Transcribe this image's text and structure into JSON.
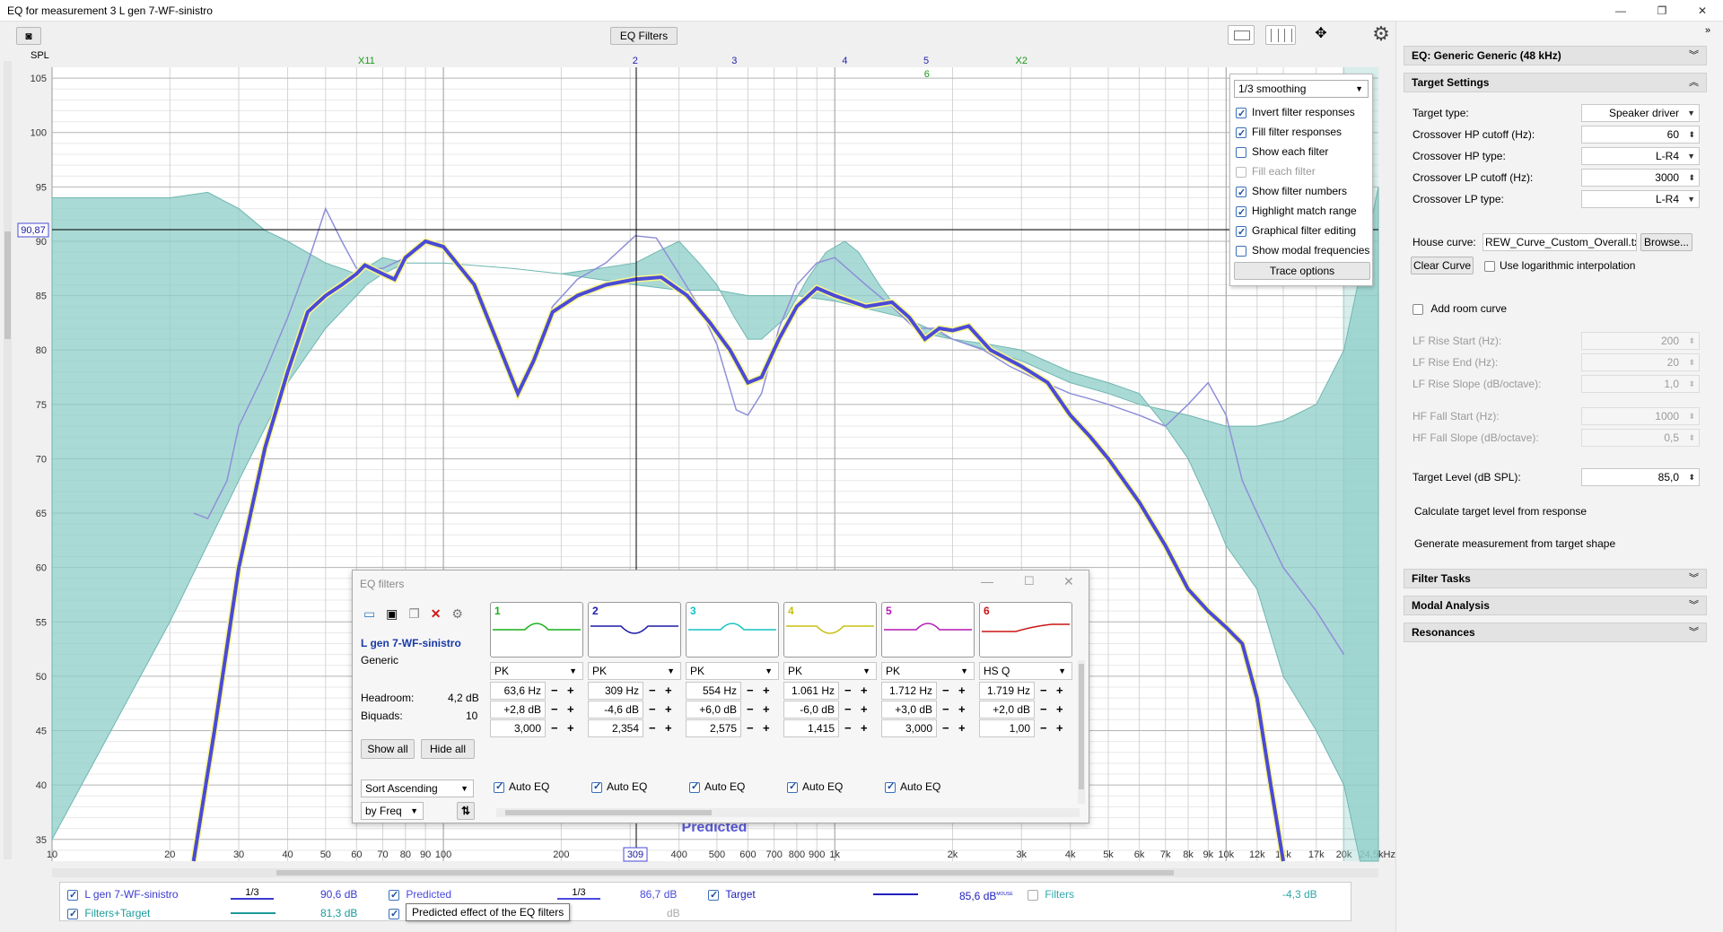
{
  "window": {
    "title": "EQ for measurement 3 L gen 7-WF-sinistro",
    "minimize": "—",
    "maximize": "❐",
    "close": "✕"
  },
  "toolbar": {
    "eq_filters_button": "EQ Filters",
    "spl_label": "SPL"
  },
  "graph": {
    "y_ticks": [
      "105",
      "100",
      "95",
      "90",
      "85",
      "80",
      "75",
      "70",
      "65",
      "60",
      "55",
      "50",
      "45",
      "40",
      "35"
    ],
    "x_ticks": [
      "10",
      "20",
      "30",
      "40",
      "50",
      "60",
      "70",
      "80",
      "90",
      "100",
      "200",
      "300",
      "400",
      "500",
      "600",
      "700",
      "800",
      "900",
      "1k",
      "2k",
      "3k",
      "4k",
      "5k",
      "6k",
      "7k",
      "8k",
      "9k",
      "10k",
      "12k",
      "14k",
      "17k",
      "20k",
      "24,5kHz"
    ],
    "x_cursor_value": "309",
    "y_cursor_value": "90,87",
    "top_markers": [
      "X11",
      "2",
      "3",
      "4",
      "5",
      "6",
      "X2"
    ],
    "predicted_label": "Predicted"
  },
  "trace_options": {
    "smoothing": "1/3 smoothing",
    "items": [
      {
        "label": "Invert filter responses",
        "checked": true,
        "disabled": false
      },
      {
        "label": "Fill filter responses",
        "checked": true,
        "disabled": false
      },
      {
        "label": "Show each filter",
        "checked": false,
        "disabled": false
      },
      {
        "label": "Fill each filter",
        "checked": false,
        "disabled": true
      },
      {
        "label": "Show filter numbers",
        "checked": true,
        "disabled": false
      },
      {
        "label": "Highlight match range",
        "checked": true,
        "disabled": false
      },
      {
        "label": "Graphical filter editing",
        "checked": true,
        "disabled": false
      },
      {
        "label": "Show modal frequencies",
        "checked": false,
        "disabled": false
      }
    ],
    "button": "Trace options"
  },
  "eq_window": {
    "title": "EQ filters",
    "measurement_name": "L gen 7-WF-sinistro",
    "equaliser": "Generic",
    "headroom_label": "Headroom:",
    "headroom_value": "4,2 dB",
    "biquads_label": "Biquads:",
    "biquads_value": "10",
    "show_all": "Show all",
    "hide_all": "Hide all",
    "sort_select": "Sort Ascending",
    "sort_by": "by Freq",
    "filters": [
      {
        "num": "1",
        "color": "#19b019",
        "type": "PK",
        "freq": "63,6 Hz",
        "gain": "+2,8 dB",
        "q": "3,000",
        "auto": "Auto EQ",
        "shape": "peak"
      },
      {
        "num": "2",
        "color": "#1c1ca8",
        "type": "PK",
        "freq": "309 Hz",
        "gain": "-4,6 dB",
        "q": "2,354",
        "auto": "Auto EQ",
        "shape": "dip"
      },
      {
        "num": "3",
        "color": "#14c2c2",
        "type": "PK",
        "freq": "554 Hz",
        "gain": "+6,0 dB",
        "q": "2,575",
        "auto": "Auto EQ",
        "shape": "peak"
      },
      {
        "num": "4",
        "color": "#c8c012",
        "type": "PK",
        "freq": "1.061 Hz",
        "gain": "-6,0 dB",
        "q": "1,415",
        "auto": "Auto EQ",
        "shape": "dip"
      },
      {
        "num": "5",
        "color": "#b418b4",
        "type": "PK",
        "freq": "1.712 Hz",
        "gain": "+3,0 dB",
        "q": "3,000",
        "auto": "Auto EQ",
        "shape": "peak"
      },
      {
        "num": "6",
        "color": "#cc1414",
        "type": "HS Q",
        "freq": "1.719 Hz",
        "gain": "+2,0 dB",
        "q": "1,00",
        "auto": "",
        "shape": "shelf"
      }
    ]
  },
  "legend": {
    "items": [
      {
        "label": "L gen 7-WF-sinistro",
        "value": "90,6 dB",
        "smoothing": "1/3",
        "color": "#3a3ad0"
      },
      {
        "label": "Predicted",
        "value": "86,7 dB",
        "smoothing": "1/3",
        "color": "#4a4ae0"
      },
      {
        "label": "Target",
        "value": "85,6 dB",
        "color": "#2020c0"
      },
      {
        "label": "Filters",
        "value": "-4,3 dB",
        "color": "#30a8a8"
      },
      {
        "label": "Filters+Target",
        "value": "81,3 dB",
        "color": "#1e9a9a"
      }
    ],
    "mouse_tag": "MOUSE",
    "hidden_value": "dB",
    "tooltip": "Predicted effect of the EQ filters"
  },
  "panel": {
    "header": "EQ: Generic Generic (48 kHz)",
    "target_settings": "Target Settings",
    "target_type_label": "Target type:",
    "target_type": "Speaker driver",
    "hp_cutoff_label": "Crossover HP cutoff (Hz):",
    "hp_cutoff": "60",
    "hp_type_label": "Crossover HP type:",
    "hp_type": "L-R4",
    "lp_cutoff_label": "Crossover LP cutoff (Hz):",
    "lp_cutoff": "3000",
    "lp_type_label": "Crossover LP type:",
    "lp_type": "L-R4",
    "house_curve_label": "House curve:",
    "house_curve": "REW_Curve_Custom_Overall.txt",
    "browse": "Browse...",
    "clear_curve": "Clear Curve",
    "log_interp": "Use logarithmic interpolation",
    "add_room_curve": "Add room curve",
    "lf_rise_start_label": "LF Rise Start (Hz):",
    "lf_rise_start": "200",
    "lf_rise_end_label": "LF Rise End (Hz):",
    "lf_rise_end": "20",
    "lf_rise_slope_label": "LF Rise Slope (dB/octave):",
    "lf_rise_slope": "1,0",
    "hf_fall_start_label": "HF Fall Start (Hz):",
    "hf_fall_start": "1000",
    "hf_fall_slope_label": "HF Fall Slope (dB/octave):",
    "hf_fall_slope": "0,5",
    "target_level_label": "Target Level (dB SPL):",
    "target_level": "85,0",
    "calc_target": "Calculate target level from response",
    "gen_measurement": "Generate measurement from target shape",
    "filter_tasks": "Filter Tasks",
    "modal_analysis": "Modal Analysis",
    "resonances": "Resonances"
  },
  "colors": {
    "fill": "#8ecdc8",
    "measurement": "#8f8fd8",
    "predicted": "#4a4ad8",
    "target": "#fbf78a",
    "gridline": "#d9d9d9"
  }
}
